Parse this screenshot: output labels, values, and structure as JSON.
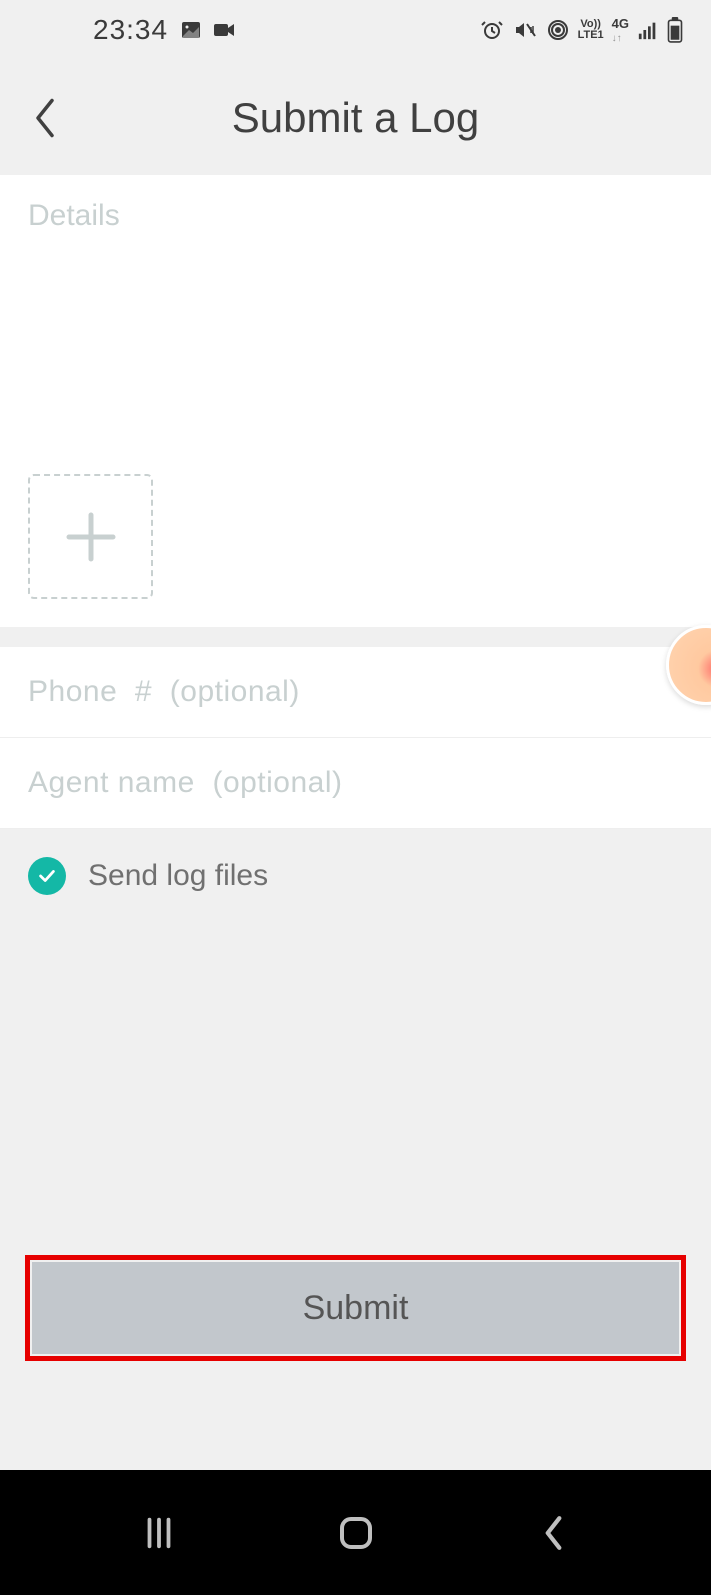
{
  "status": {
    "time": "23:34"
  },
  "header": {
    "title": "Submit a Log"
  },
  "form": {
    "details_placeholder": "Details",
    "phone_placeholder": "Phone  #  (optional)",
    "agent_placeholder": "Agent name  (optional)",
    "send_logs_label": "Send log files",
    "send_logs_checked": true,
    "submit_label": "Submit"
  }
}
